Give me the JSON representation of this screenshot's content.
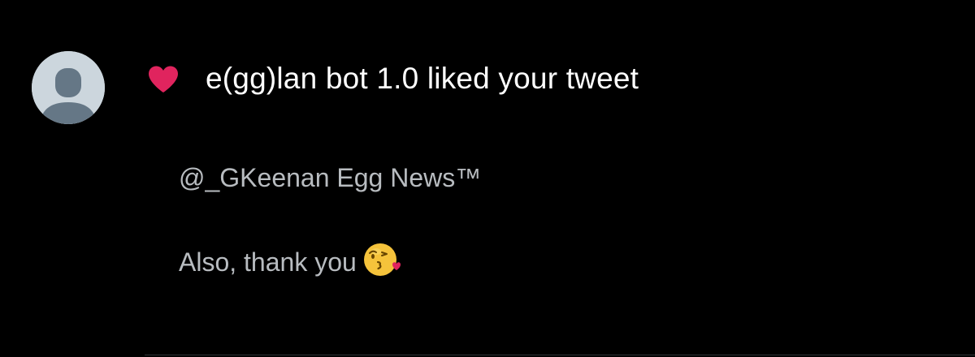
{
  "notification": {
    "type_icon": "heart-icon",
    "avatar_icon": "default-user-avatar",
    "headline": "e(gg)lan bot 1.0 liked your tweet",
    "tweet": {
      "mention": "@_GKeenan Egg News™",
      "text": "Also, thank you",
      "emoji": "face-throwing-kiss-emoji"
    }
  },
  "colors": {
    "background": "#000000",
    "heart": "#e0245e",
    "headline_text": "#ffffff",
    "tweet_text": "#b8bcc0",
    "avatar_bg": "#ccd6dd",
    "avatar_figure": "#657786",
    "divider": "#2f3336"
  }
}
